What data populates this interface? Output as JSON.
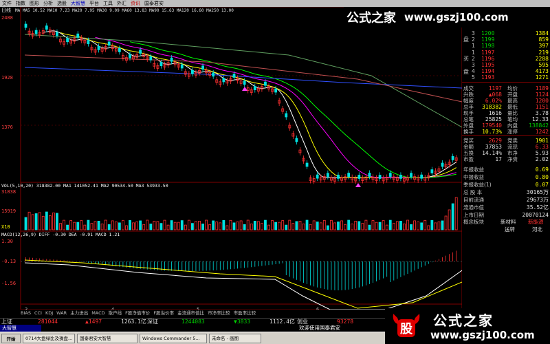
{
  "menu": [
    "文件",
    "指数",
    "图形",
    "分析",
    "选股",
    "大智慧",
    "平台",
    "工具",
    "外汇",
    "资讯",
    "国泰君安"
  ],
  "watermark": {
    "cn": "公式之家",
    "url": "www.gszj100.com"
  },
  "chart_header": {
    "period": "日线",
    "ma_text": "MA MA5 10.52 MA10 7.23 MA20 7.95 MA30 9.09 MA60 13.83 MA90 15.63 MA120 16.60 MA250 13.00",
    "vol_text": "VOL(5,10,20)  318382.00  MA1 141052.41  MA2 90534.50  MA3 53933.50",
    "macd_text": "MACD(12,26,9) DIFF -0.30 DEA -0.91 MACD 1.21"
  },
  "chart_data": [
    {
      "type": "line",
      "title": "",
      "ylim": [
        0,
        2488
      ],
      "yticks": [
        "2488",
        "1928",
        "1376"
      ],
      "note_x": [
        "3",
        "4",
        "5",
        "6"
      ]
    },
    {
      "type": "bar",
      "title": "",
      "yticks": [
        "31838",
        "15919",
        "X10"
      ]
    },
    {
      "type": "bar",
      "title": "",
      "yticks": [
        "1.30",
        "-0.13",
        "-1.56"
      ]
    }
  ],
  "orderbook": {
    "sell_label": "盘",
    "buy_label": "买",
    "buy_label2": "盘",
    "sell": [
      {
        "lvl": "3",
        "price": "1200",
        "vol": "1384"
      },
      {
        "lvl": "2",
        "price": "1199",
        "vol": "859"
      },
      {
        "lvl": "1",
        "price": "1198",
        "vol": "397"
      }
    ],
    "buy": [
      {
        "lvl": "1",
        "price": "1197",
        "vol": "219"
      },
      {
        "lvl": "2",
        "price": "1196",
        "vol": "2288"
      },
      {
        "lvl": "3",
        "price": "1195",
        "vol": "595"
      },
      {
        "lvl": "4",
        "price": "1194",
        "vol": "4173"
      },
      {
        "lvl": "5",
        "price": "1193",
        "vol": "1271"
      }
    ]
  },
  "quote": [
    {
      "l1": "成交",
      "v1": "1197",
      "c1": "red",
      "l2": "均价",
      "v2": "1189",
      "c2": "red"
    },
    {
      "l1": "升跌",
      "v1": "▲068",
      "c1": "red",
      "l2": "开盘",
      "v2": "1124",
      "c2": "red"
    },
    {
      "l1": "幅度",
      "v1": "6.02%",
      "c1": "red",
      "l2": "最高",
      "v2": "1200",
      "c2": "red"
    },
    {
      "l1": "总手",
      "v1": "318382",
      "c1": "yellow",
      "l2": "最低",
      "v2": "1151",
      "c2": "red"
    },
    {
      "l1": "现手",
      "v1": "1616",
      "c1": "white",
      "l2": "量比",
      "v2": "3.78",
      "c2": "white"
    },
    {
      "l1": "总笔",
      "v1": "25825",
      "c1": "white",
      "l2": "笔均",
      "v2": "12.33",
      "c2": "white"
    },
    {
      "l1": "外盘",
      "v1": "179540",
      "c1": "red",
      "l2": "内盘",
      "v2": "138842",
      "c2": "green"
    },
    {
      "l1": "换手",
      "v1": "10.73%",
      "c1": "yellow",
      "l2": "涨停",
      "v2": "1242",
      "c2": "red"
    },
    {
      "l1": "竞买",
      "v1": "2629",
      "c1": "red",
      "l2": "竞卖",
      "v2": "1901",
      "c2": "yellow"
    },
    {
      "l1": "金额",
      "v1": "37853",
      "c1": "white",
      "l2": "流现",
      "v2": "6.33",
      "c2": "red"
    },
    {
      "l1": "五换",
      "v1": "14.14%",
      "c1": "white",
      "l2": "市净",
      "v2": "5.93",
      "c2": "white"
    },
    {
      "l1": "市盈",
      "v1": "17",
      "c1": "white",
      "l2": "净资",
      "v2": "2.02",
      "c2": "white"
    }
  ],
  "finance": [
    {
      "label": "年报收益",
      "value": "0.69"
    },
    {
      "label": "中报收益",
      "value": "0.80"
    },
    {
      "label": "季报收益(1)",
      "value": "0.07"
    },
    {
      "label": "总 股 本",
      "value": "30165万"
    },
    {
      "label": "目前流通",
      "value": "29673万"
    },
    {
      "label": "流通市值",
      "value": "35.52亿"
    },
    {
      "label": "上市日期",
      "value": "20070124"
    }
  ],
  "concept": {
    "label": "概念板块",
    "v1": "新材料",
    "v2": "新能源",
    "v3": "送转",
    "v4": "河北"
  },
  "tabs": [
    "BIAS",
    "CCI",
    "KDJ",
    "WAR",
    "主力进出",
    "MACD",
    "散户线",
    "F股净值市价",
    "F股溢价率",
    "金流通市值比",
    "市净率比较",
    "市盈率比较"
  ],
  "status": {
    "sh_label": "上证",
    "sh_val": "281044",
    "sh_chg": "▲1497",
    "sh_amt": "1263.1亿",
    "sz_label": "深证",
    "sz_val": "1244083",
    "sz_chg": "▼3833",
    "sz_amt": "1112.4亿",
    "cy_label": "创业",
    "cy_val": "93278"
  },
  "welcome": "欢迎使用国泰君安",
  "app_name": "大智慧",
  "taskbar": {
    "start": "开始",
    "items": [
      "0714大盘绿比及操盘...",
      "国泰君安大智慧",
      "Windows Commander 5...",
      "未命名 - 画图"
    ]
  },
  "logo_char": "股"
}
